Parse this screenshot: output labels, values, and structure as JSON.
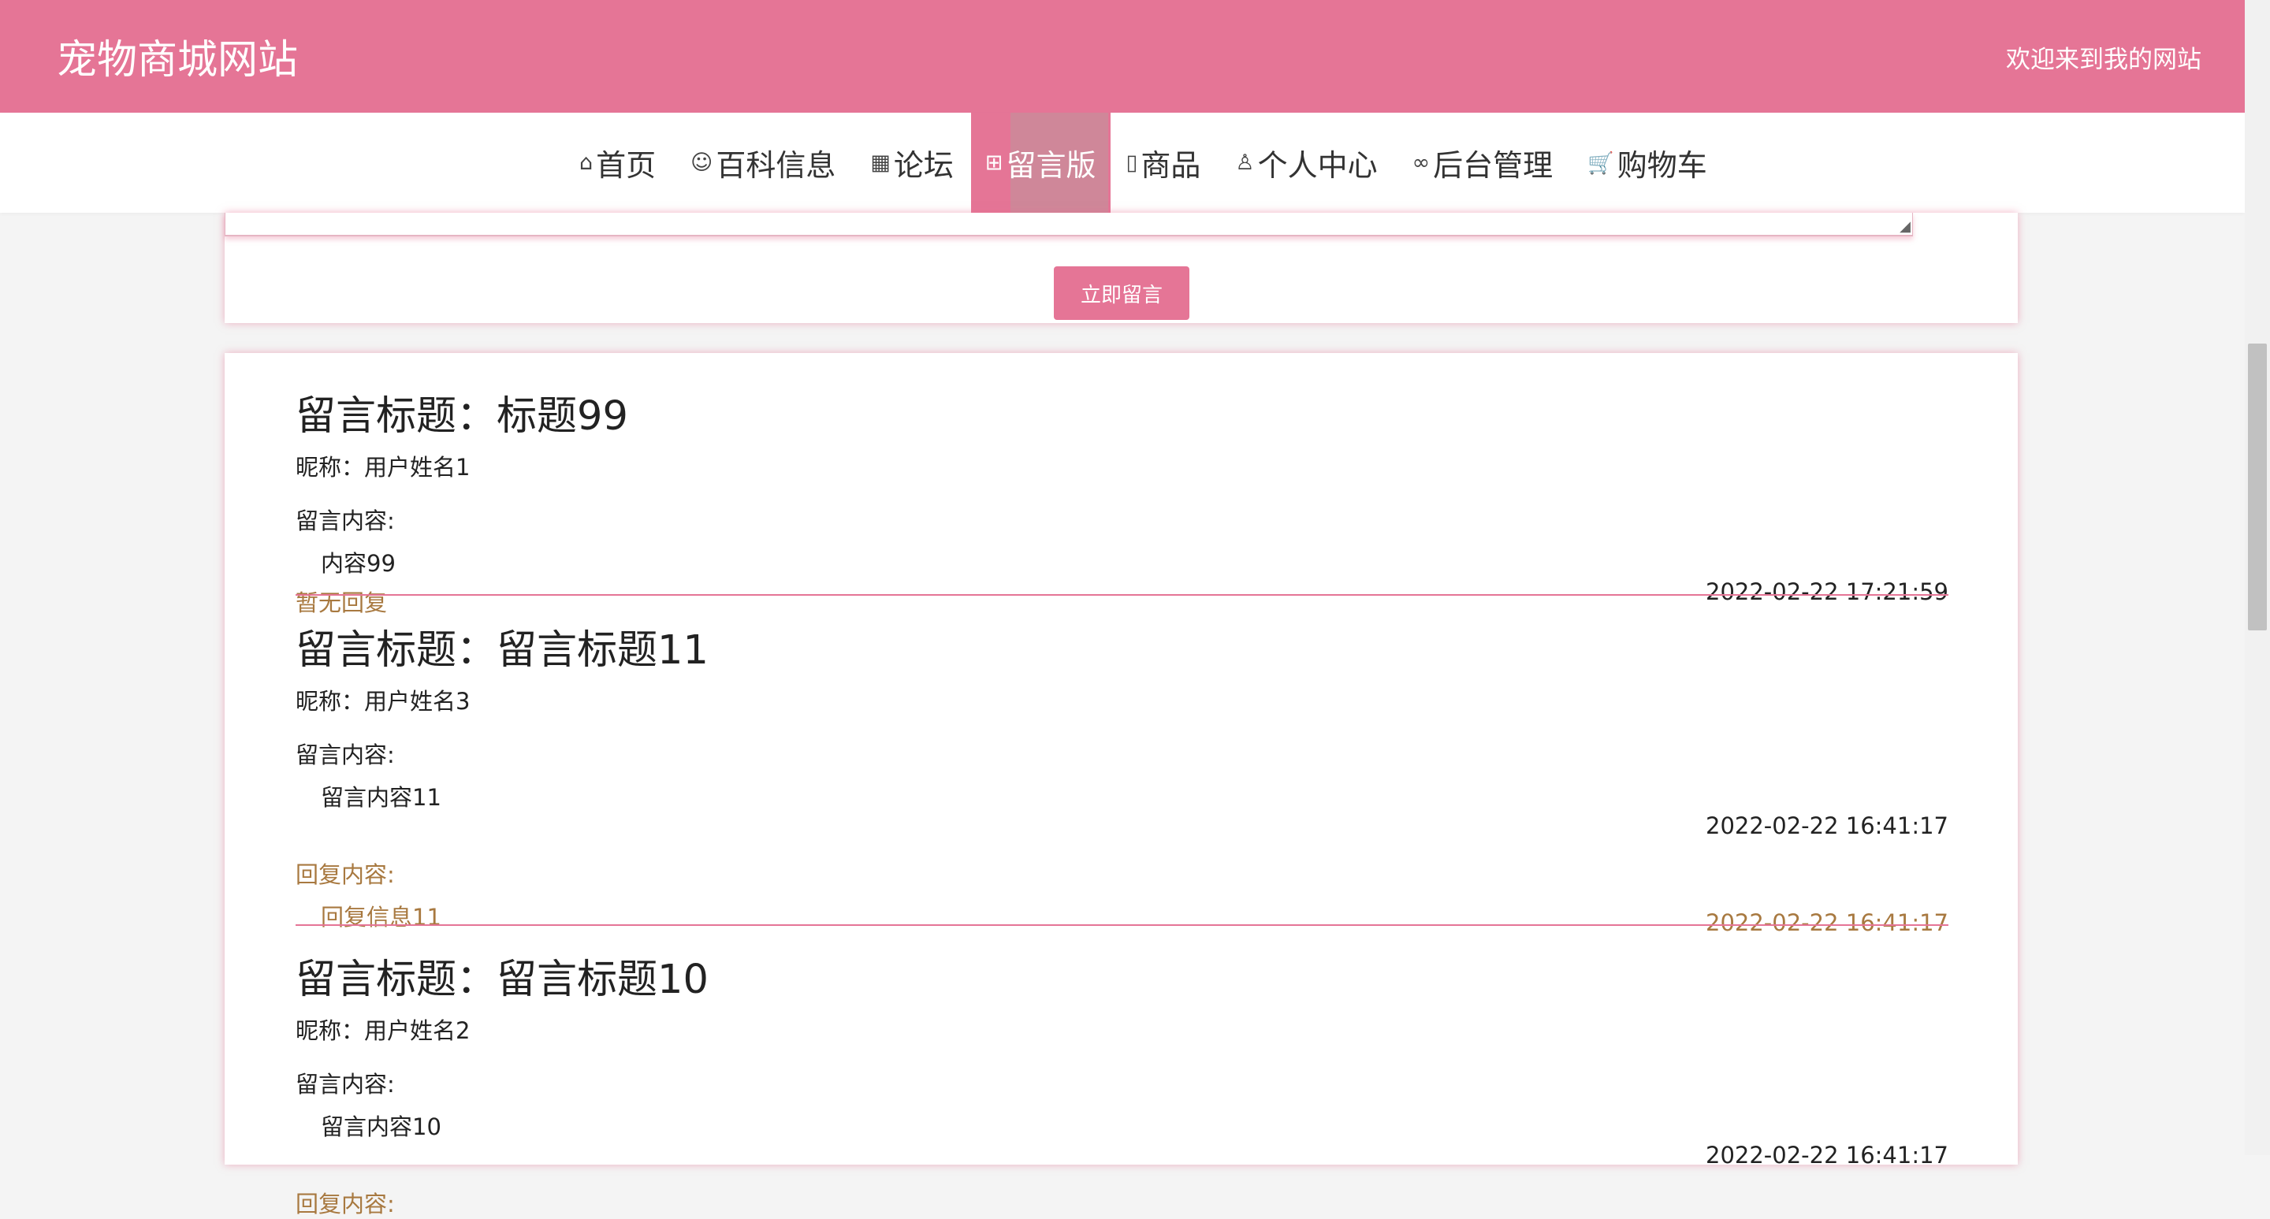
{
  "header": {
    "site_title": "宠物商城网站",
    "welcome": "欢迎来到我的网站"
  },
  "nav": {
    "items": [
      {
        "icon": "⌂",
        "label": "首页"
      },
      {
        "icon": "☺",
        "label": "百科信息"
      },
      {
        "icon": "▦",
        "label": "论坛"
      },
      {
        "icon": "⊞",
        "label": "留言版"
      },
      {
        "icon": "▯",
        "label": "商品"
      },
      {
        "icon": "♙",
        "label": "个人中心"
      },
      {
        "icon": "∞",
        "label": "后台管理"
      },
      {
        "icon": "🛒",
        "label": "购物车"
      }
    ],
    "active_index": 3
  },
  "compose": {
    "submit_label": "立即留言"
  },
  "messages": [
    {
      "title": "留言标题：标题99",
      "nick": "昵称：用户姓名1",
      "content_label": "留言内容:",
      "content": "内容99",
      "no_reply": "暂无回复",
      "time": "2022-02-22 17:21:59"
    },
    {
      "title": "留言标题：留言标题11",
      "nick": "昵称：用户姓名3",
      "content_label": "留言内容:",
      "content": "留言内容11",
      "time": "2022-02-22 16:41:17",
      "reply_label": "回复内容:",
      "reply_content": "回复信息11",
      "reply_time": "2022-02-22 16:41:17"
    },
    {
      "title": "留言标题：留言标题10",
      "nick": "昵称：用户姓名2",
      "content_label": "留言内容:",
      "content": "留言内容10",
      "time": "2022-02-22 16:41:17",
      "reply_label": "回复内容:"
    }
  ],
  "colors": {
    "brand": "#e57596",
    "reply_text": "#a87940"
  }
}
